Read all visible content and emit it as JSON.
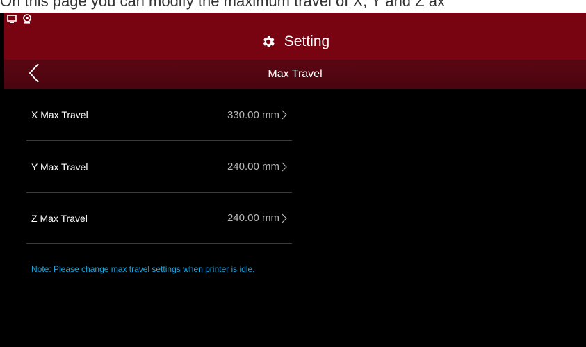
{
  "caption": "On this page you can modify the maximum travel of X, Y and Z ax",
  "header": {
    "title": "Setting",
    "icon": "gear-icon"
  },
  "subheader": {
    "title": "Max Travel",
    "back_icon": "chevron-left-icon"
  },
  "settings": [
    {
      "label": "X Max Travel",
      "value": "330.00 mm"
    },
    {
      "label": "Y Max Travel",
      "value": "240.00 mm"
    },
    {
      "label": "Z Max Travel",
      "value": "240.00 mm"
    }
  ],
  "note": "Note: Please change max travel settings when printer is idle.",
  "colors": {
    "topbar": "#790411",
    "subbar": "#4e0510",
    "note": "#1aa7e0",
    "background": "#000000"
  }
}
